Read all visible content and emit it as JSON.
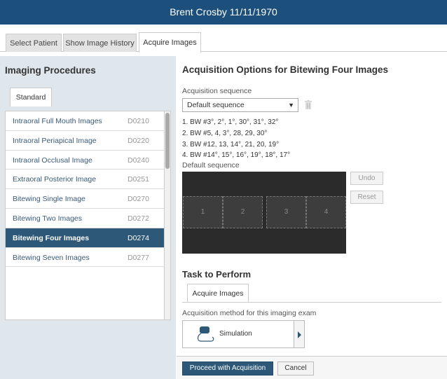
{
  "header": {
    "title": "Brent Crosby 11/11/1970"
  },
  "tabs": [
    {
      "label": "Select Patient"
    },
    {
      "label": "Show Image History"
    },
    {
      "label": "Acquire Images"
    }
  ],
  "left": {
    "title": "Imaging Procedures",
    "tab": "Standard",
    "procedures": [
      {
        "name": "Intraoral Full Mouth Images",
        "code": "D0210"
      },
      {
        "name": "Intraoral Periapical Image",
        "code": "D0220"
      },
      {
        "name": "Intraoral Occlusal Image",
        "code": "D0240"
      },
      {
        "name": "Extraoral Posterior Image",
        "code": "D0251"
      },
      {
        "name": "Bitewing Single Image",
        "code": "D0270"
      },
      {
        "name": "Bitewing Two Images",
        "code": "D0272"
      },
      {
        "name": "Bitewing Four Images",
        "code": "D0274"
      },
      {
        "name": "Bitewing Seven Images",
        "code": "D0277"
      }
    ]
  },
  "main": {
    "title": "Acquisition Options for Bitewing Four Images",
    "sequence_label": "Acquisition sequence",
    "sequence_value": "Default sequence",
    "sequence_lines": [
      "1. BW   #3°, 2°, 1°, 30°, 31°, 32°",
      "2. BW   #5, 4, 3°, 28, 29, 30°",
      "3. BW   #12, 13, 14°, 21, 20, 19°",
      "4. BW   #14°, 15°, 16°, 19°, 18°, 17°"
    ],
    "sequence_caption": "Default sequence",
    "slots": [
      "1",
      "2",
      "3",
      "4"
    ],
    "undo": "Undo",
    "reset": "Reset"
  },
  "task": {
    "title": "Task to Perform",
    "tab": "Acquire Images",
    "method_label": "Acquisition method for this imaging exam",
    "method": "Simulation"
  },
  "footer": {
    "proceed": "Proceed with Acquisition",
    "cancel": "Cancel"
  }
}
